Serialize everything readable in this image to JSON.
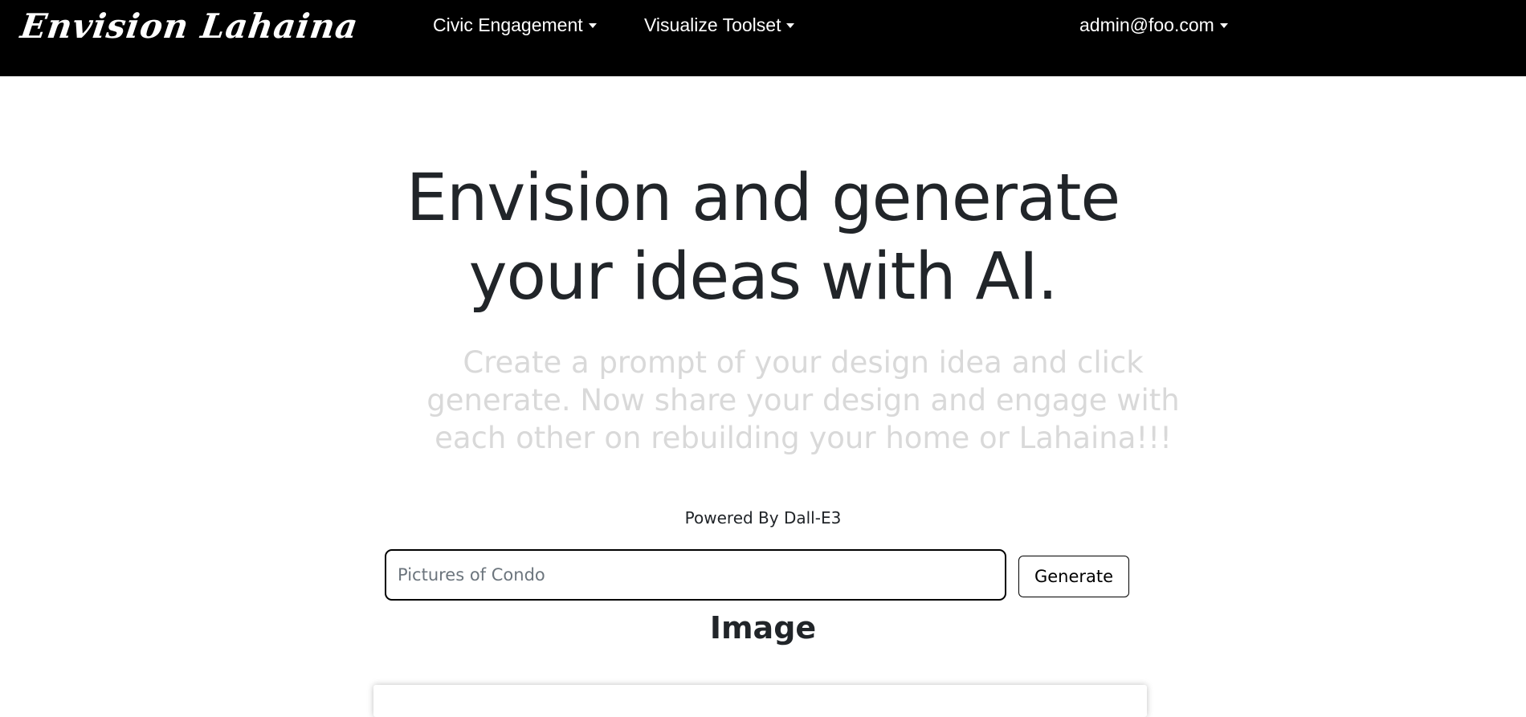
{
  "navbar": {
    "brand": "Envision Lahaina",
    "items": [
      {
        "label": "Civic Engagement"
      },
      {
        "label": "Visualize Toolset"
      }
    ],
    "user": {
      "label": "admin@foo.com"
    }
  },
  "hero": {
    "title": "Envision and generate your ideas with AI.",
    "subtitle": "Create a prompt of your design idea and click generate. Now share your design and engage with each other on rebuilding your home or Lahaina!!!"
  },
  "generator": {
    "powered_by": "Powered By Dall-E3",
    "prompt_placeholder": "Pictures of Condo",
    "prompt_value": "",
    "generate_label": "Generate"
  },
  "result": {
    "heading": "Image"
  },
  "colors": {
    "navbar_bg": "#000000",
    "text_dark": "#212529",
    "subtitle_gray": "#d9d9d9"
  },
  "icons": {
    "dropdown": "caret-down-icon"
  }
}
